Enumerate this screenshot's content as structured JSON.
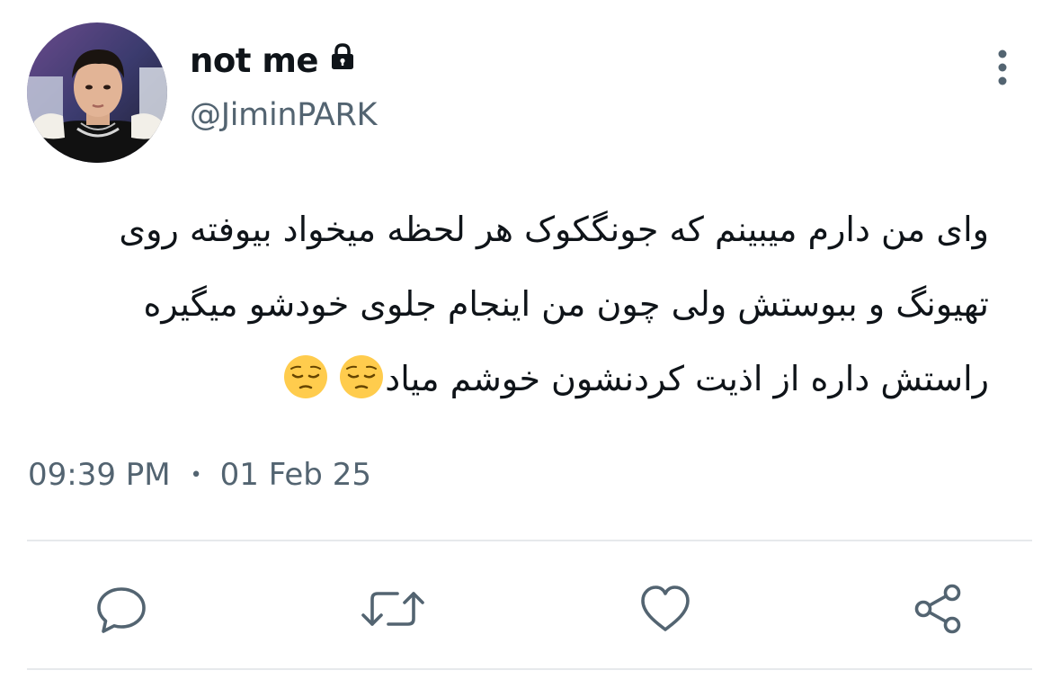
{
  "tweet": {
    "display_name": "not me",
    "handle": "@JiminPARK",
    "text_lines": [
      "وای من دارم میبینم که جونگکوک هر لحظه میخواد بیوفته روی",
      "تهیونگ و ببوستش ولی چون من اینجام جلوی خودشو میگیره",
      "راستش داره از اذیت کردنشون خوشم میاد"
    ],
    "emojis": [
      "pensive-face",
      "pensive-face"
    ],
    "time": "09:39 PM",
    "separator": "•",
    "date": "01 Feb 25"
  },
  "icons": {
    "lock": "lock-icon",
    "more": "more-vertical-icon",
    "reply": "reply-icon",
    "retweet": "retweet-icon",
    "like": "heart-icon",
    "share": "share-icon"
  },
  "colors": {
    "primary_text": "#0f1419",
    "secondary_text": "#536471",
    "divider": "#e6e9ec",
    "emoji_yellow": "#ffcc4d"
  }
}
